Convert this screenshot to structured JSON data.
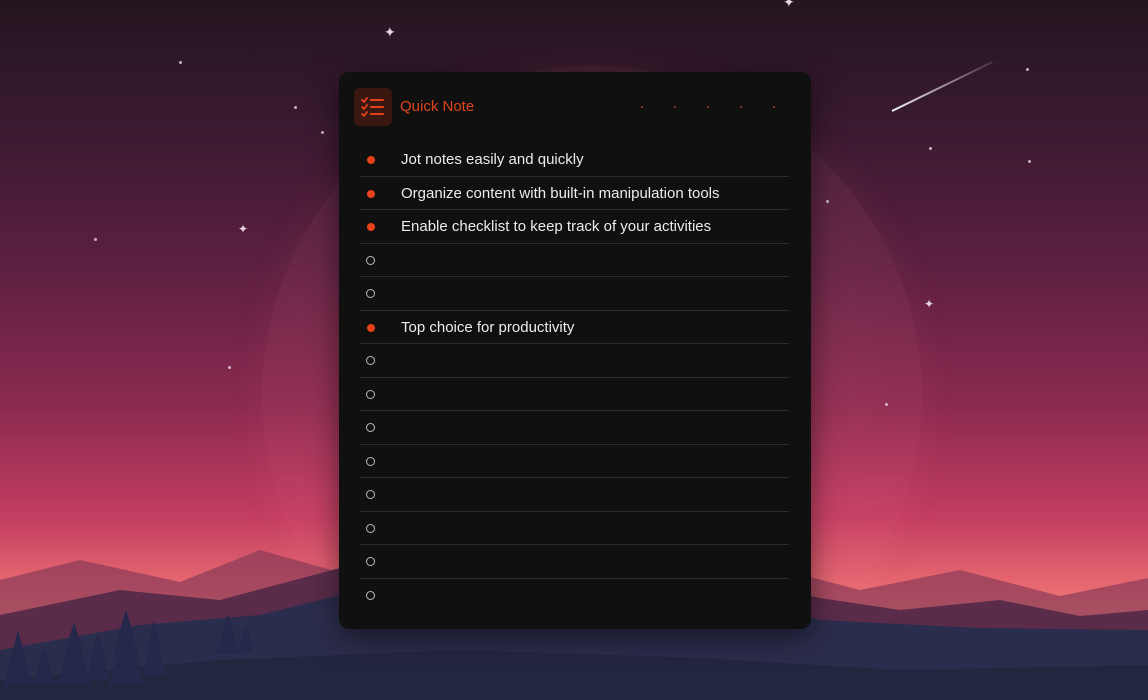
{
  "app": {
    "title": "Quick Note",
    "icon": "checklist-icon",
    "accent_color": "#e8421a"
  },
  "notes": [
    {
      "text": "Jot notes easily and quickly",
      "checked": true
    },
    {
      "text": "Organize content with built-in manipulation tools",
      "checked": true
    },
    {
      "text": "Enable checklist to keep track of your activities",
      "checked": true
    },
    {
      "text": "",
      "checked": false
    },
    {
      "text": "",
      "checked": false
    },
    {
      "text": "Top choice for productivity",
      "checked": true
    },
    {
      "text": "",
      "checked": false
    },
    {
      "text": "",
      "checked": false
    },
    {
      "text": "",
      "checked": false
    },
    {
      "text": "",
      "checked": false
    },
    {
      "text": "",
      "checked": false
    },
    {
      "text": "",
      "checked": false
    },
    {
      "text": "",
      "checked": false
    },
    {
      "text": "",
      "checked": false
    }
  ]
}
